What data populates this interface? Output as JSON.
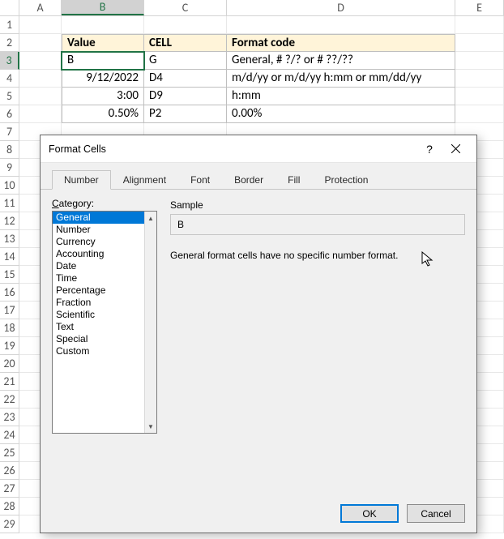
{
  "columns": [
    "A",
    "B",
    "C",
    "D",
    "E"
  ],
  "rows": [
    "1",
    "2",
    "3",
    "4",
    "5",
    "6",
    "7",
    "8",
    "9",
    "10",
    "11",
    "12",
    "13",
    "14",
    "15",
    "16",
    "17",
    "18",
    "19",
    "20",
    "21",
    "22",
    "23",
    "24",
    "25",
    "26",
    "27",
    "28",
    "29"
  ],
  "active_col": "B",
  "active_row": "3",
  "table": {
    "headers": {
      "value": "Value",
      "cell": "CELL",
      "format": "Format code"
    },
    "rows": [
      {
        "value": "B",
        "cell": "G",
        "format": "General, # ?/? or # ??/??"
      },
      {
        "value": "9/12/2022",
        "cell": "D4",
        "format": "m/d/yy or m/d/yy h:mm or mm/dd/yy"
      },
      {
        "value": "3:00",
        "cell": "D9",
        "format": "h:mm"
      },
      {
        "value": "0.50%",
        "cell": "P2",
        "format": "0.00%"
      }
    ]
  },
  "dialog": {
    "title": "Format Cells",
    "tabs": [
      "Number",
      "Alignment",
      "Font",
      "Border",
      "Fill",
      "Protection"
    ],
    "active_tab": 0,
    "category_label": "Category:",
    "categories": [
      "General",
      "Number",
      "Currency",
      "Accounting",
      "Date",
      "Time",
      "Percentage",
      "Fraction",
      "Scientific",
      "Text",
      "Special",
      "Custom"
    ],
    "selected_category": 0,
    "sample_label": "Sample",
    "sample_value": "B",
    "description": "General format cells have no specific number format.",
    "ok": "OK",
    "cancel": "Cancel",
    "help_glyph": "?"
  }
}
